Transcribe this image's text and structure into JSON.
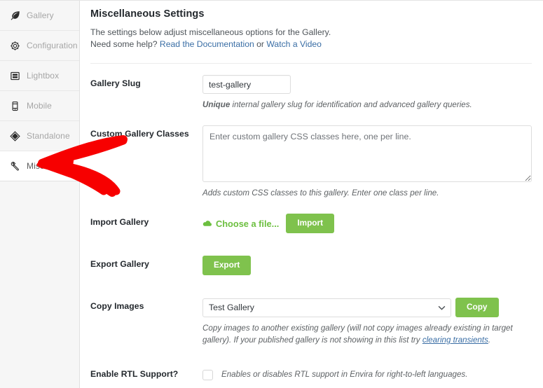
{
  "sidebar": {
    "items": [
      {
        "label": "Gallery",
        "icon": "leaf-icon",
        "active": false
      },
      {
        "label": "Configuration",
        "icon": "gear-icon",
        "active": false
      },
      {
        "label": "Lightbox",
        "icon": "lightbox-icon",
        "active": false
      },
      {
        "label": "Mobile",
        "icon": "mobile-icon",
        "active": false
      },
      {
        "label": "Standalone",
        "icon": "diamond-icon",
        "active": false
      },
      {
        "label": "Misc",
        "icon": "wrench-icon",
        "active": true
      }
    ]
  },
  "main": {
    "page_title": "Miscellaneous Settings",
    "intro_line1": "The settings below adjust miscellaneous options for the Gallery.",
    "intro_prefix": "Need some help?",
    "link_docs": "Read the Documentation",
    "intro_or": "or",
    "link_video": "Watch a Video",
    "rows": {
      "gallery_slug": {
        "label": "Gallery Slug",
        "value": "test-gallery",
        "desc_strong": "Unique",
        "desc_rest": "internal gallery slug for identification and advanced gallery queries."
      },
      "custom_classes": {
        "label": "Custom Gallery Classes",
        "placeholder": "Enter custom gallery CSS classes here, one per line.",
        "value": "",
        "desc": "Adds custom CSS classes to this gallery. Enter one class per line."
      },
      "import_gallery": {
        "label": "Import Gallery",
        "choose_file_label": "Choose a file...",
        "button_label": "Import"
      },
      "export_gallery": {
        "label": "Export Gallery",
        "button_label": "Export"
      },
      "copy_images": {
        "label": "Copy Images",
        "selected": "Test Gallery",
        "options": [
          "Test Gallery"
        ],
        "button_label": "Copy",
        "desc_part1": "Copy images to another existing gallery (will not copy images already existing in target gallery). If your published gallery is not showing in this list try ",
        "desc_link": "clearing transients",
        "desc_part2": "."
      },
      "rtl_support": {
        "label": "Enable RTL Support?",
        "checked": false,
        "desc": "Enables or disables RTL support in Envira for right-to-left languages."
      }
    }
  },
  "annotation": {
    "type": "arrow",
    "color": "#f70000",
    "points_to": "sidebar-item-misc"
  }
}
